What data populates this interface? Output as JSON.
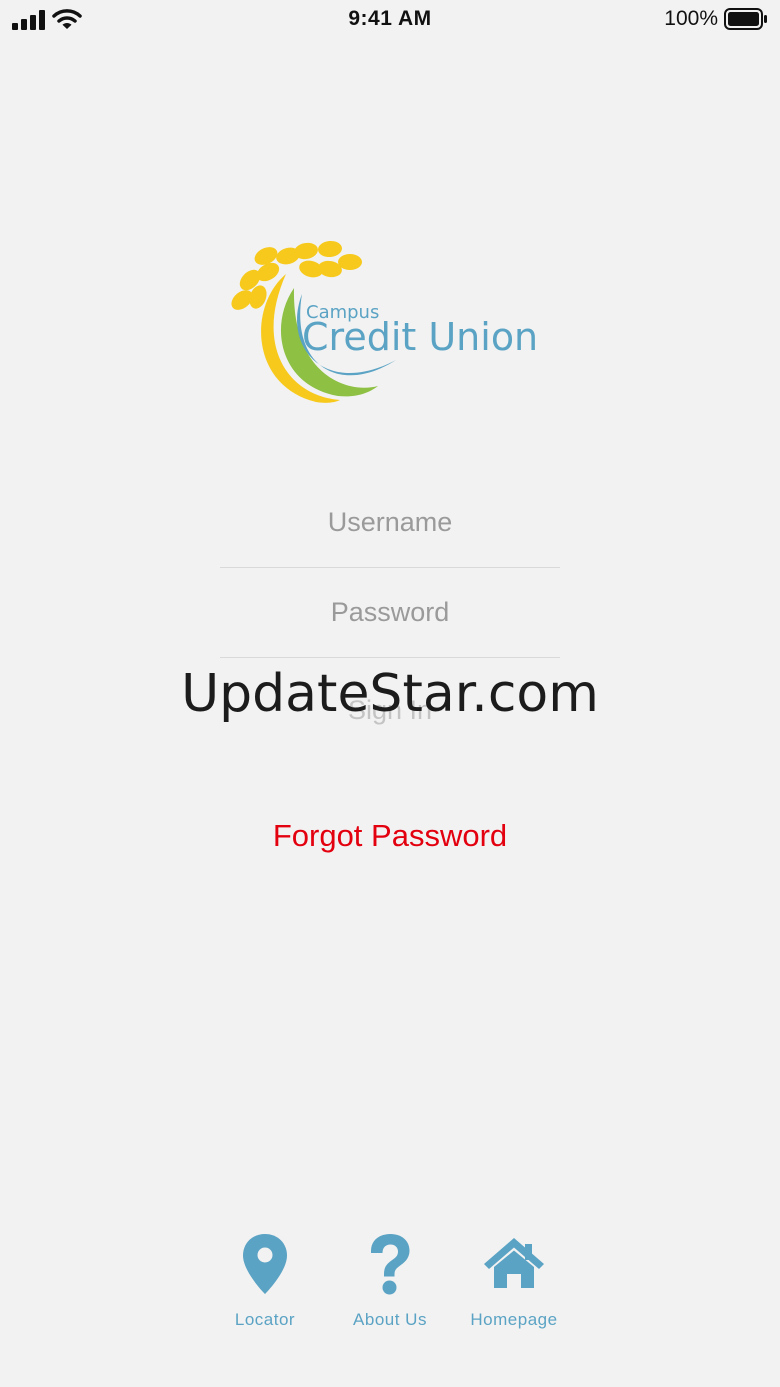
{
  "status_bar": {
    "time": "9:41 AM",
    "battery": "100%"
  },
  "logo": {
    "line1": "Campus",
    "line2": "Credit Union"
  },
  "form": {
    "username_placeholder": "Username",
    "password_placeholder": "Password",
    "sign_in_label": "Sign In"
  },
  "watermark": "UpdateStar.com",
  "forgot_password_label": "Forgot Password",
  "nav": {
    "items": [
      {
        "label": "Locator",
        "icon": "map-pin-icon"
      },
      {
        "label": "About Us",
        "icon": "question-mark-icon"
      },
      {
        "label": "Homepage",
        "icon": "house-icon"
      }
    ]
  },
  "colors": {
    "background": "#f2f2f2",
    "accent_blue": "#5ba3c4",
    "forgot_red": "#e3000f",
    "logo_yellow": "#f7c91c",
    "logo_green": "#8dc043"
  }
}
